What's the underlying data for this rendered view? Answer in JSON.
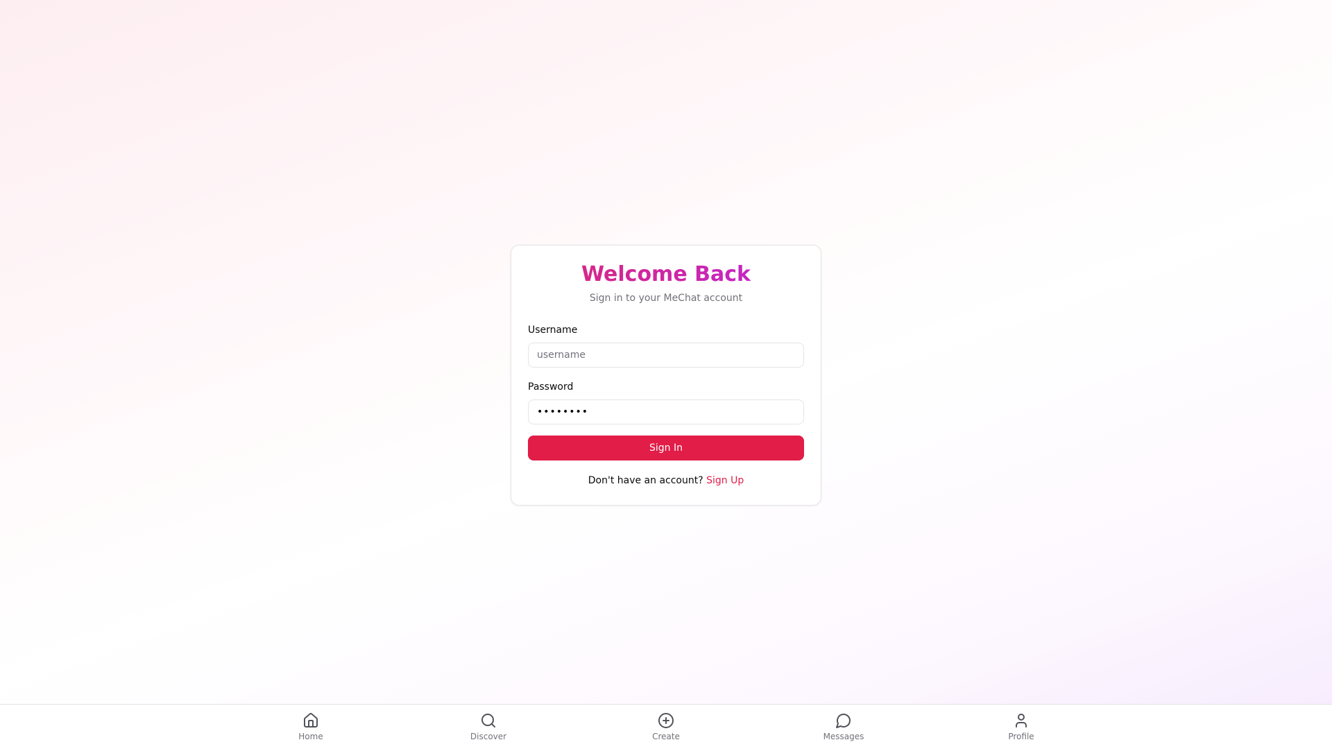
{
  "login": {
    "title": "Welcome Back",
    "subtitle": "Sign in to your MeChat account",
    "username_label": "Username",
    "username_placeholder": "username",
    "password_label": "Password",
    "password_value": "password",
    "submit_label": "Sign In",
    "signup_prompt": "Don't have an account?",
    "signup_link": "Sign Up"
  },
  "nav": {
    "items": [
      {
        "label": "Home",
        "icon": "home-icon"
      },
      {
        "label": "Discover",
        "icon": "search-icon"
      },
      {
        "label": "Create",
        "icon": "plus-circle-icon"
      },
      {
        "label": "Messages",
        "icon": "message-circle-icon"
      },
      {
        "label": "Profile",
        "icon": "user-icon"
      }
    ]
  },
  "colors": {
    "accent": "#e11d48",
    "title_gradient_start": "#db2777",
    "title_gradient_end": "#c026d3"
  }
}
